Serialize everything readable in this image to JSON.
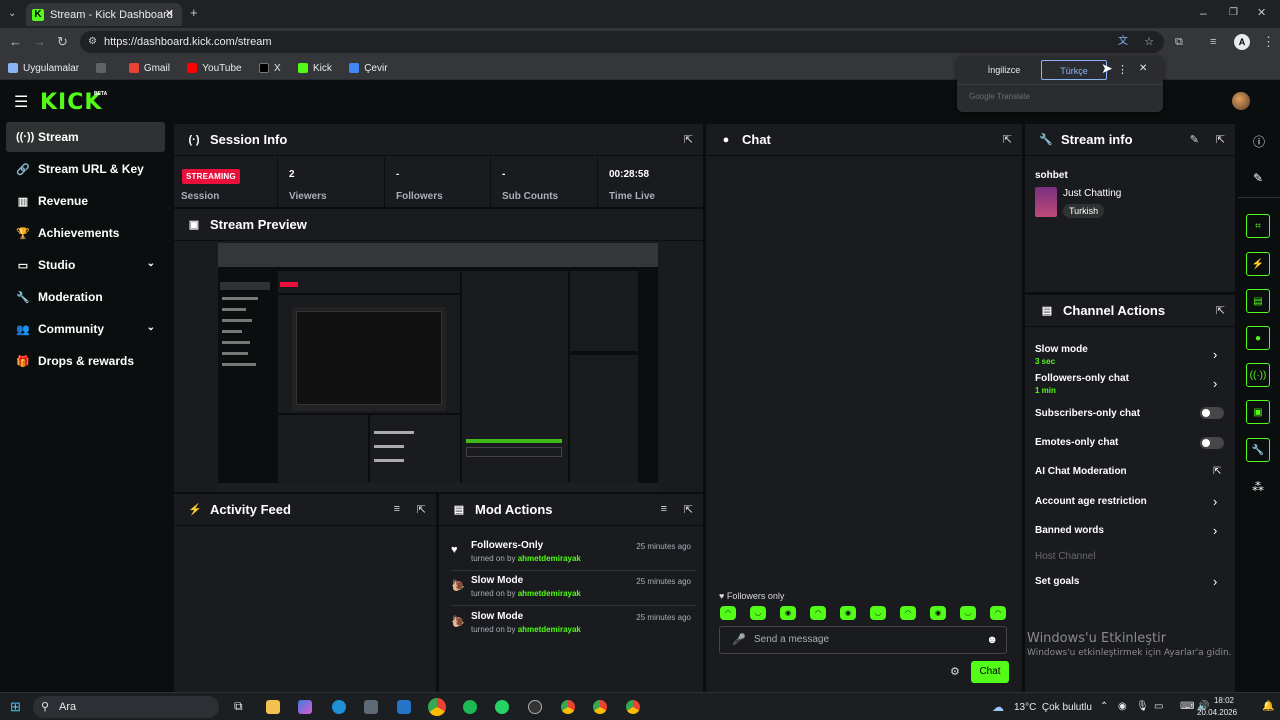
{
  "browser": {
    "tab_title": "Stream - Kick Dashboard",
    "url": "https://dashboard.kick.com/stream",
    "bookmarks": [
      "Uygulamalar",
      "Gmail",
      "YouTube",
      "X",
      "Kick",
      "Çevir"
    ]
  },
  "translate_popup": {
    "lang_source": "İngilizce",
    "lang_target": "Türkçe",
    "footer": "Google Translate"
  },
  "site": {
    "logo": "KICK",
    "logo_badge": "BETA"
  },
  "sidebar": {
    "items": [
      {
        "label": "Stream",
        "icon": "broadcast-icon"
      },
      {
        "label": "Stream URL & Key",
        "icon": "link-icon"
      },
      {
        "label": "Revenue",
        "icon": "chart-icon"
      },
      {
        "label": "Achievements",
        "icon": "trophy-icon"
      },
      {
        "label": "Studio",
        "icon": "monitor-icon"
      },
      {
        "label": "Moderation",
        "icon": "wrench-icon"
      },
      {
        "label": "Community",
        "icon": "people-icon"
      },
      {
        "label": "Drops & rewards",
        "icon": "gift-icon"
      }
    ]
  },
  "session_info": {
    "title": "Session Info",
    "status": "STREAMING",
    "status_label": "Session",
    "viewers_value": "2",
    "viewers_label": "Viewers",
    "followers_value": "-",
    "followers_label": "Followers",
    "subs_value": "-",
    "subs_label": "Sub Counts",
    "time_value": "00:28:58",
    "time_label": "Time Live"
  },
  "stream_preview": {
    "title": "Stream Preview"
  },
  "activity_feed": {
    "title": "Activity Feed"
  },
  "mod_actions": {
    "title": "Mod Actions",
    "rows": [
      {
        "title": "Followers-Only",
        "prefix": "turned on by",
        "user": "ahmetdemirayak",
        "time": "25 minutes ago"
      },
      {
        "title": "Slow Mode",
        "prefix": "turned on by",
        "user": "ahmetdemirayak",
        "time": "25 minutes ago"
      },
      {
        "title": "Slow Mode",
        "prefix": "turned on by",
        "user": "ahmetdemirayak",
        "time": "25 minutes ago"
      }
    ]
  },
  "chat": {
    "title": "Chat",
    "mode_notice": "Followers only",
    "placeholder": "Send a message",
    "send_label": "Chat"
  },
  "stream_info": {
    "title": "Stream info",
    "stream_title": "sohbet",
    "category": "Just Chatting",
    "language": "Turkish"
  },
  "channel_actions": {
    "title": "Channel Actions",
    "slow_mode": "Slow mode",
    "slow_mode_value": "3 sec",
    "followers_chat": "Followers-only chat",
    "followers_chat_value": "1 min",
    "subs_chat": "Subscribers-only chat",
    "emotes_chat": "Emotes-only chat",
    "ai_moderation": "AI Chat Moderation",
    "account_age": "Account age restriction",
    "banned_words": "Banned words",
    "host_channel": "Host Channel",
    "set_goals": "Set goals"
  },
  "windows_watermark": {
    "line1": "Windows'u Etkinleştir",
    "line2": "Windows'u etkinleştirmek için Ayarlar'a gidin."
  },
  "taskbar": {
    "search": "Ara",
    "weather": "13°C  Çok bulutlu",
    "time": "18:02",
    "date": "20.04.2026"
  }
}
